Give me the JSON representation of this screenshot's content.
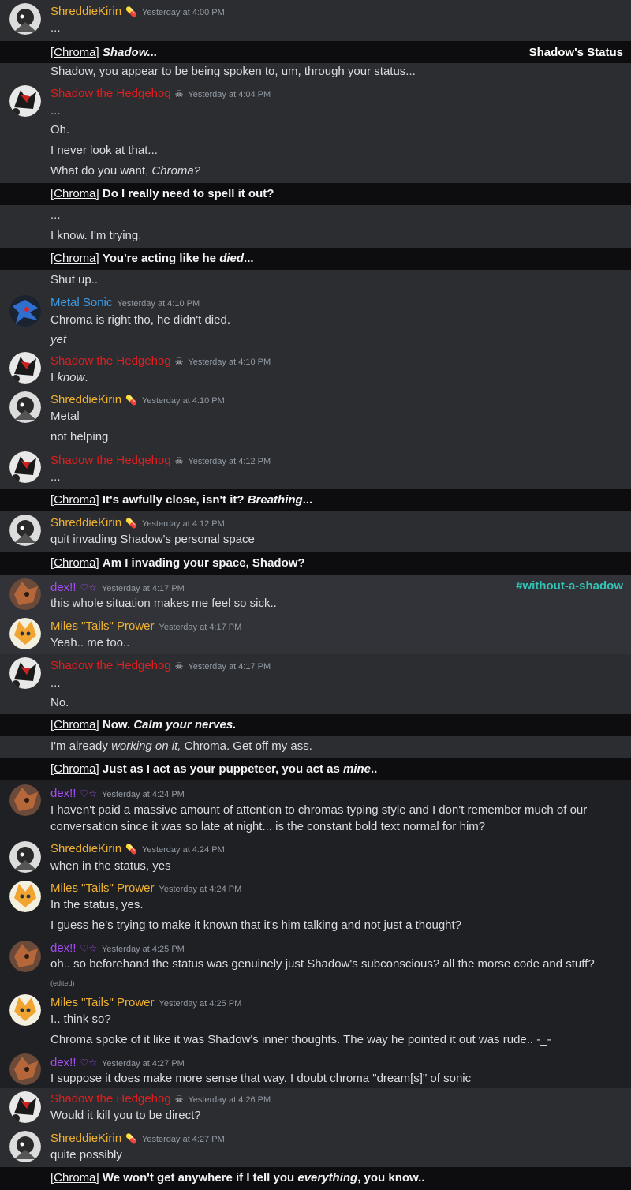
{
  "colors": {
    "shreddie": "#f0b232",
    "shadow": "#e01e1e",
    "metal": "#3b9de8",
    "dex": "#a64cf4",
    "tails": "#f0b232",
    "channel": "#33c2b4"
  },
  "status_label": "Shadow's Status",
  "channel_label": "#without-a-shadow",
  "chroma_prefix": "[Chroma]",
  "messages": {
    "m1": {
      "user": "ShreddieKirin",
      "badge": "💊",
      "time": "Yesterday at 4:00 PM",
      "l1": "..."
    },
    "c1": {
      "text": "Shadow..."
    },
    "s1": {
      "text": "Shadow, you appear to be being spoken to, um, through your status..."
    },
    "m2": {
      "user": "Shadow the Hedgehog",
      "badge": "☠",
      "time": "Yesterday at 4:04 PM",
      "l1": "...",
      "l2": "Oh.",
      "l3": "I never look at that...",
      "l4a": "What do you want, ",
      "l4b": "Chroma?"
    },
    "c2": {
      "text": "Do I really need to spell it out?"
    },
    "s2": {
      "l1": "...",
      "l2": "I know. I'm trying."
    },
    "c3": {
      "a": "You're acting like he ",
      "b": "died",
      "c": "..."
    },
    "s3": {
      "text": "Shut up.."
    },
    "m3": {
      "user": "Metal Sonic",
      "time": "Yesterday at 4:10 PM",
      "l1": "Chroma is right tho, he didn't died.",
      "l2": "yet"
    },
    "m4": {
      "user": "Shadow the Hedgehog",
      "badge": "☠",
      "time": "Yesterday at 4:10 PM",
      "l1a": "I ",
      "l1b": "know",
      "l1c": "."
    },
    "m5": {
      "user": "ShreddieKirin",
      "badge": "💊",
      "time": "Yesterday at 4:10 PM",
      "l1": "Metal",
      "l2": "not helping"
    },
    "m6": {
      "user": "Shadow the Hedgehog",
      "badge": "☠",
      "time": "Yesterday at 4:12 PM",
      "l1": "..."
    },
    "c4": {
      "a": "It's awfully close, isn't it? ",
      "b": "Breathing",
      "c": "..."
    },
    "m7": {
      "user": "ShreddieKirin",
      "badge": "💊",
      "time": "Yesterday at 4:12 PM",
      "l1": "quit invading Shadow's personal space"
    },
    "c5": {
      "text": "Am I invading your space, Shadow?"
    },
    "m8": {
      "user": "dex!!",
      "badge": "♡☆",
      "time": "Yesterday at 4:17 PM",
      "l1": "this whole situation makes me feel so sick.."
    },
    "m9": {
      "user": "Miles \"Tails\" Prower",
      "time": "Yesterday at 4:17 PM",
      "l1": "Yeah.. me too.."
    },
    "m10": {
      "user": "Shadow the Hedgehog",
      "badge": "☠",
      "time": "Yesterday at 4:17 PM",
      "l1": "...",
      "l2": "No."
    },
    "c6": {
      "a": "Now. ",
      "b": "Calm your nerves."
    },
    "s4": {
      "a": "I'm already ",
      "b": "working on it,",
      "c": " Chroma. Get off my ass."
    },
    "c7": {
      "a": "Just as I act as your puppeteer, you act as ",
      "b": "mine",
      "c": ".."
    },
    "m11": {
      "user": "dex!!",
      "badge": "♡☆",
      "time": "Yesterday at 4:24 PM",
      "l1": "I haven't paid a massive amount of attention to chromas typing style and I don't remember much of our conversation since it was so late at night... is the constant bold text normal for him?"
    },
    "m12": {
      "user": "ShreddieKirin",
      "badge": "💊",
      "time": "Yesterday at 4:24 PM",
      "l1": "when in the status, yes"
    },
    "m13": {
      "user": "Miles \"Tails\" Prower",
      "time": "Yesterday at 4:24 PM",
      "l1": "In the status, yes.",
      "l2": "I guess he's trying to make it known that it's him talking and not just a thought?"
    },
    "m14": {
      "user": "dex!!",
      "badge": "♡☆",
      "time": "Yesterday at 4:25 PM",
      "l1": "oh.. so beforehand the status was genuinely just Shadow's subconscious? all the morse code and stuff?",
      "edited": "(edited)"
    },
    "m15": {
      "user": "Miles \"Tails\" Prower",
      "time": "Yesterday at 4:25 PM",
      "l1": "I.. think so?",
      "l2": "Chroma spoke of it like it was Shadow's inner thoughts. The way he pointed it out was rude.. -_-"
    },
    "m16": {
      "user": "dex!!",
      "badge": "♡☆",
      "time": "Yesterday at 4:27 PM",
      "l1": "I suppose it does make more sense that way. I doubt chroma \"dream[s]\" of sonic"
    },
    "m17": {
      "user": "Shadow the Hedgehog",
      "badge": "☠",
      "time": "Yesterday at 4:26 PM",
      "l1": "Would it kill you to be direct?"
    },
    "m18": {
      "user": "ShreddieKirin",
      "badge": "💊",
      "time": "Yesterday at 4:27 PM",
      "l1": "quite possibly"
    },
    "c8": {
      "a": "We won't get anywhere if I tell you ",
      "b": "everything",
      "c": ", you know.."
    }
  }
}
